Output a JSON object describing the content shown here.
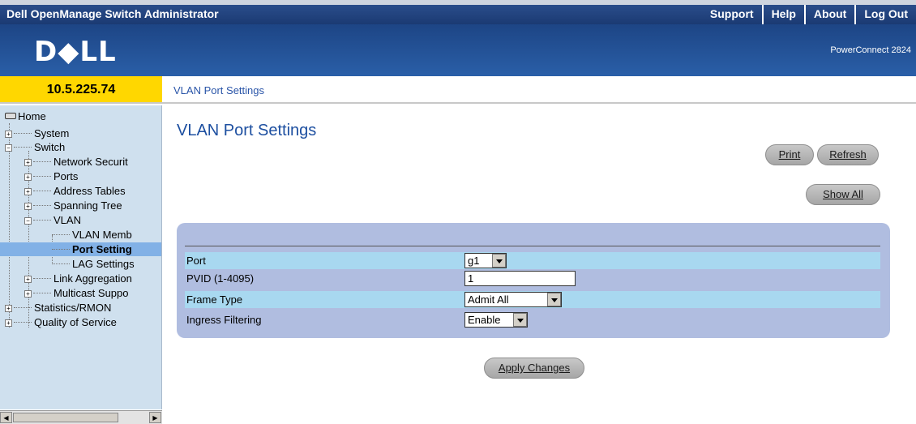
{
  "header": {
    "app_title": "Dell OpenManage Switch Administrator",
    "links": [
      "Support",
      "Help",
      "About",
      "Log Out"
    ]
  },
  "brand": {
    "logo": "D◆LL",
    "model": "PowerConnect 2824"
  },
  "ip": "10.5.225.74",
  "breadcrumb": "VLAN Port Settings",
  "tree": {
    "home": "Home",
    "system": "System",
    "switch": "Switch",
    "network_security": "Network Securit",
    "ports": "Ports",
    "address_tables": "Address Tables",
    "spanning_tree": "Spanning Tree",
    "vlan": "VLAN",
    "vlan_membership": "VLAN Memb",
    "port_settings": "Port Setting",
    "lag_settings": "LAG Settings",
    "link_aggregation": "Link Aggregation",
    "multicast_support": "Multicast Suppo",
    "statistics_rmon": "Statistics/RMON",
    "quality_of_service": "Quality of Service"
  },
  "main": {
    "title": "VLAN Port Settings",
    "print_label": "Print",
    "refresh_label": "Refresh",
    "show_all_label": "Show All",
    "apply_label": "Apply Changes"
  },
  "form": {
    "port_label": "Port",
    "port_value": "g1",
    "pvid_label": "PVID (1-4095)",
    "pvid_value": "1",
    "frame_type_label": "Frame Type",
    "frame_type_value": "Admit All",
    "ingress_label": "Ingress Filtering",
    "ingress_value": "Enable"
  },
  "colors": {
    "header_bg": "#1b3a73",
    "ip_bg": "#ffd700",
    "tree_bg": "#cfe0ee",
    "panel_bg": "#b0bde0",
    "row_alt": "#a8d8f0",
    "title_color": "#1d4fa0"
  }
}
